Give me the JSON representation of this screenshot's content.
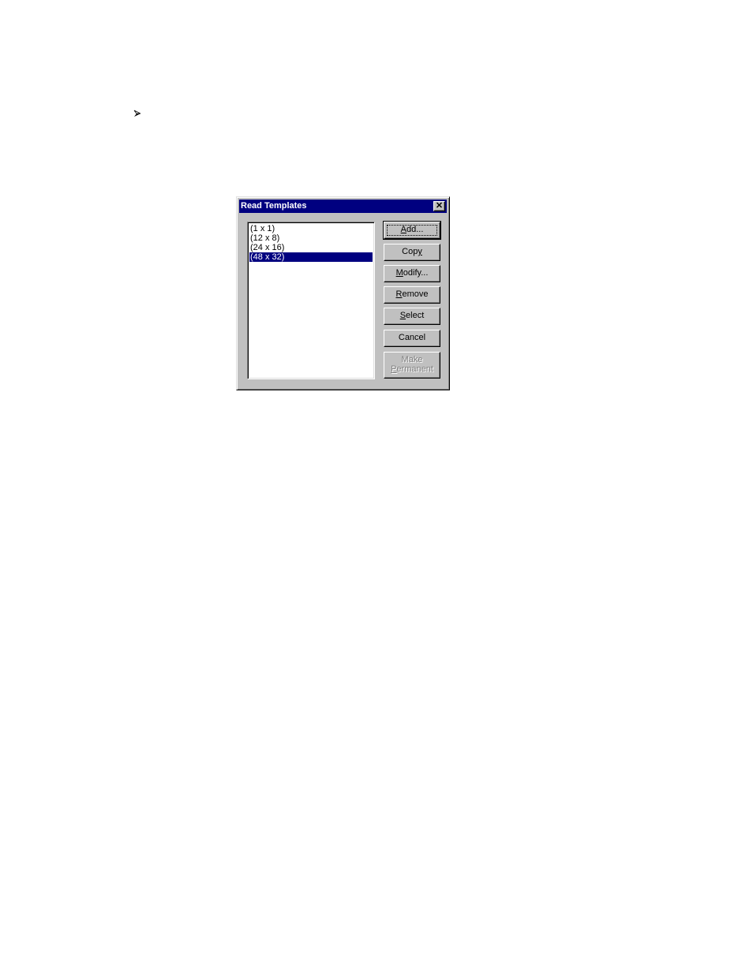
{
  "bullet": {
    "icon": "arrowhead-bullet-icon"
  },
  "dialog": {
    "title": "Read Templates",
    "close_icon": "close-icon",
    "list": {
      "items": [
        {
          "label": "(1 x 1)",
          "selected": false
        },
        {
          "label": "(12 x 8)",
          "selected": false
        },
        {
          "label": "(24 x 16)",
          "selected": false
        },
        {
          "label": "(48 x 32)",
          "selected": true
        }
      ]
    },
    "buttons": {
      "add": {
        "pre": "",
        "mnemonic": "A",
        "post": "dd..."
      },
      "copy": {
        "pre": "Cop",
        "mnemonic": "y",
        "post": ""
      },
      "modify": {
        "pre": "",
        "mnemonic": "M",
        "post": "odify..."
      },
      "remove": {
        "pre": "",
        "mnemonic": "R",
        "post": "emove"
      },
      "select": {
        "pre": "",
        "mnemonic": "S",
        "post": "elect"
      },
      "cancel": {
        "label": "Cancel"
      },
      "make_permanent": {
        "line1": "Make",
        "line2_mnemonic": "P",
        "line2_rest": "ermanent",
        "enabled": false
      }
    }
  }
}
